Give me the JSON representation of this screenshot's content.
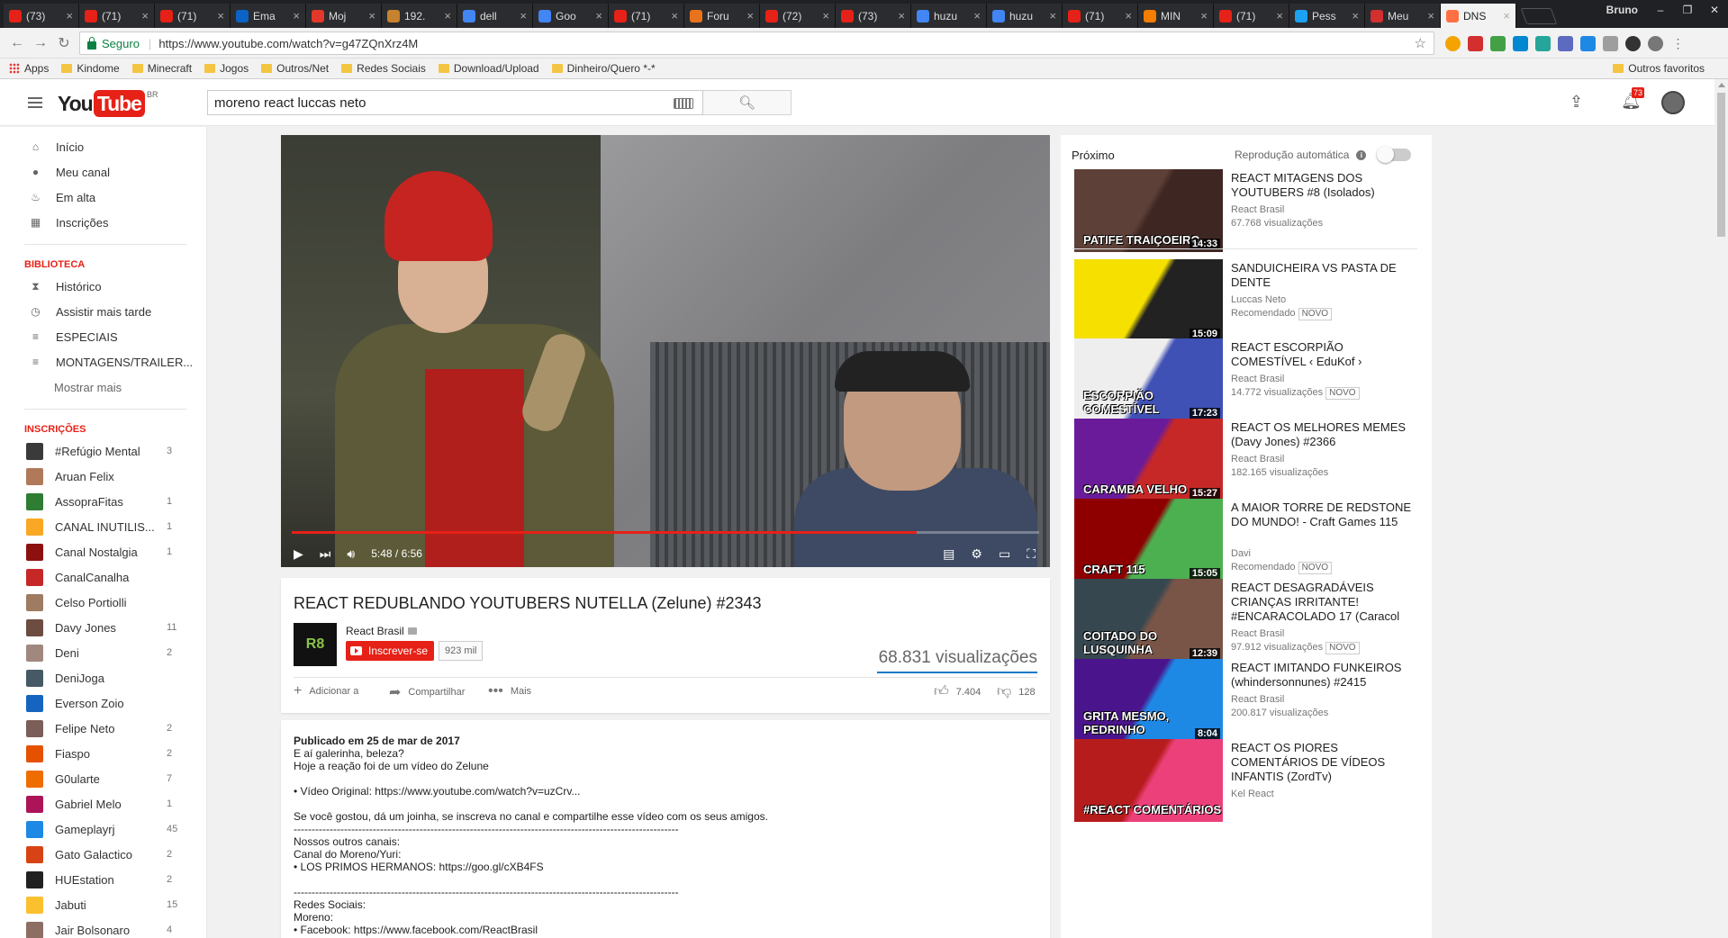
{
  "browser": {
    "tabs": [
      {
        "label": "(73)",
        "color": "#e62117",
        "active": false
      },
      {
        "label": "(71)",
        "color": "#e62117",
        "active": false
      },
      {
        "label": "(71)",
        "color": "#e62117",
        "active": false
      },
      {
        "label": "Ema",
        "color": "#0b63c5",
        "active": false
      },
      {
        "label": "Moj",
        "color": "#e2372a",
        "active": false
      },
      {
        "label": "192.",
        "color": "#c7822f",
        "active": false
      },
      {
        "label": "dell",
        "color": "#4285f4",
        "active": false
      },
      {
        "label": "Goo",
        "color": "#4285f4",
        "active": false
      },
      {
        "label": "(71)",
        "color": "#e62117",
        "active": false
      },
      {
        "label": "Foru",
        "color": "#e8731c",
        "active": false
      },
      {
        "label": "(72)",
        "color": "#e62117",
        "active": false
      },
      {
        "label": "(73)",
        "color": "#e62117",
        "active": false
      },
      {
        "label": "huzu",
        "color": "#4285f4",
        "active": false
      },
      {
        "label": "huzu",
        "color": "#4285f4",
        "active": false
      },
      {
        "label": "(71)",
        "color": "#e62117",
        "active": false
      },
      {
        "label": "MIN",
        "color": "#f57d00",
        "active": false
      },
      {
        "label": "(71)",
        "color": "#e62117",
        "active": false
      },
      {
        "label": "Pess",
        "color": "#1da1f2",
        "active": false
      },
      {
        "label": "Meu",
        "color": "#d32f2f",
        "active": false
      },
      {
        "label": "DNS",
        "color": "#ff7043",
        "active": true
      }
    ],
    "user": "Bruno",
    "secure_label": "Seguro",
    "url": "https://www.youtube.com/watch?v=g47ZQnXrz4M",
    "bookmarks": [
      "Apps",
      "Kindome",
      "Minecraft",
      "Jogos",
      "Outros/Net",
      "Redes Sociais",
      "Download/Upload",
      "Dinheiro/Quero *-*"
    ],
    "other_bookmarks": "Outros favoritos"
  },
  "header": {
    "logo_you": "You",
    "logo_tube": "Tube",
    "logo_region": "BR",
    "search_value": "moreno react luccas neto",
    "notif_count": "73"
  },
  "sidebar": {
    "nav": [
      {
        "label": "Início",
        "icon": "home-icon"
      },
      {
        "label": "Meu canal",
        "icon": "person-icon"
      },
      {
        "label": "Em alta",
        "icon": "flame-icon"
      },
      {
        "label": "Inscrições",
        "icon": "subscriptions-icon"
      }
    ],
    "library_title": "BIBLIOTECA",
    "library": [
      {
        "label": "Histórico",
        "icon": "hourglass-icon"
      },
      {
        "label": "Assistir mais tarde",
        "icon": "clock-icon"
      },
      {
        "label": "ESPECIAIS",
        "icon": "playlist-icon"
      },
      {
        "label": "MONTAGENS/TRAILER...",
        "icon": "playlist-icon"
      }
    ],
    "show_more": "Mostrar mais",
    "subs_title": "INSCRIÇÕES",
    "subs": [
      {
        "name": "#Refúgio Mental",
        "count": "3",
        "color": "#3a3a3a"
      },
      {
        "name": "Aruan Felix",
        "count": "",
        "color": "#b07a5a"
      },
      {
        "name": "AssopraFitas",
        "count": "1",
        "color": "#2e7d32"
      },
      {
        "name": "CANAL INUTILIS...",
        "count": "1",
        "color": "#f9a825"
      },
      {
        "name": "Canal Nostalgia",
        "count": "1",
        "color": "#8d1010"
      },
      {
        "name": "CanalCanalha",
        "count": "",
        "color": "#c62828"
      },
      {
        "name": "Celso Portiolli",
        "count": "",
        "color": "#9e7b61"
      },
      {
        "name": "Davy Jones",
        "count": "11",
        "color": "#6d4c41"
      },
      {
        "name": "Deni",
        "count": "2",
        "color": "#a1887f"
      },
      {
        "name": "DeniJoga",
        "count": "",
        "color": "#455a64"
      },
      {
        "name": "Everson Zoio",
        "count": "",
        "color": "#1565c0"
      },
      {
        "name": "Felipe Neto",
        "count": "2",
        "color": "#7b5e57"
      },
      {
        "name": "Fiaspo",
        "count": "2",
        "color": "#e65100"
      },
      {
        "name": "G0ularte",
        "count": "7",
        "color": "#ef6c00"
      },
      {
        "name": "Gabriel Melo",
        "count": "1",
        "color": "#ad1457"
      },
      {
        "name": "Gameplayrj",
        "count": "45",
        "color": "#1e88e5"
      },
      {
        "name": "Gato Galactico",
        "count": "2",
        "color": "#d84315"
      },
      {
        "name": "HUEstation",
        "count": "2",
        "color": "#212121"
      },
      {
        "name": "Jabuti",
        "count": "15",
        "color": "#fbc02d"
      },
      {
        "name": "Jair Bolsonaro",
        "count": "4",
        "color": "#8d6e63"
      }
    ]
  },
  "player": {
    "time": "5:48 / 6:56",
    "progress": 0.8357
  },
  "video": {
    "title": "REACT REDUBLANDO YOUTUBERS NUTELLA (Zelune) #2343",
    "channel": "React Brasil",
    "subscribe": "Inscrever-se",
    "sub_count": "923 mil",
    "views": "68.831 visualizações",
    "add": "Adicionar a",
    "share": "Compartilhar",
    "more": "Mais",
    "likes": "7.404",
    "dislikes": "128"
  },
  "description": {
    "published": "Publicado em 25 de mar de 2017",
    "lines": [
      "E aí galerinha, beleza?",
      "Hoje a reação foi de um vídeo do Zelune",
      "",
      "• Vídeo Original: https://www.youtube.com/watch?v=uzCrv...",
      "",
      "Se você gostou, dá um joinha, se inscreva no canal e compartilhe esse vídeo com os seus amigos.",
      "-----------------------------------------------------------------------------------------------------------",
      "Nossos outros canais:",
      "Canal do Moreno/Yuri:",
      "• LOS PRIMOS HERMANOS: https://goo.gl/cXB4FS",
      "",
      "-----------------------------------------------------------------------------------------------------------",
      "Redes Sociais:",
      "Moreno:",
      "• Facebook: https://www.facebook.com/ReactBrasil"
    ]
  },
  "sidebar_right": {
    "next_label": "Próximo",
    "autoplay_label": "Reprodução automática",
    "videos": [
      {
        "title": "REACT MITAGENS DOS YOUTUBERS #8 (Isolados)",
        "channel": "React Brasil",
        "meta": "67.768 visualizações",
        "new": "",
        "duration": "14:33",
        "caption": "PATIFE TRAIÇOEIRO",
        "c1": "#5d4037",
        "c2": "#3e2723"
      },
      {
        "title": "SANDUICHEIRA VS PASTA DE DENTE",
        "channel": "Luccas Neto",
        "meta": "Recomendado",
        "new": "NOVO",
        "duration": "15:09",
        "caption": "",
        "c1": "#f5e000",
        "c2": "#222222"
      },
      {
        "title": "REACT ESCORPIÃO COMESTÍVEL ‹ EduKof ›",
        "channel": "React Brasil",
        "meta": "14.772 visualizações",
        "new": "NOVO",
        "duration": "17:23",
        "caption": "ESCORPIÃO COMESTÍVEL",
        "c1": "#eeeeee",
        "c2": "#3f51b5"
      },
      {
        "title": "REACT OS MELHORES MEMES (Davy Jones) #2366",
        "channel": "React Brasil",
        "meta": "182.165 visualizações",
        "new": "",
        "duration": "15:27",
        "caption": "CARAMBA VELHO",
        "c1": "#6a1b9a",
        "c2": "#c62828"
      },
      {
        "title": "A MAIOR TORRE DE REDSTONE DO MUNDO! - Craft Games 115",
        "channel": "Davi",
        "meta": "Recomendado",
        "new": "NOVO",
        "duration": "15:05",
        "caption": "CRAFT 115",
        "c1": "#8e0000",
        "c2": "#4caf50"
      },
      {
        "title": "REACT DESAGRADÁVEIS CRIANÇAS IRRITANTE! #ENCARACOLADO 17 (Caracol",
        "channel": "React Brasil",
        "meta": "97.912 visualizações",
        "new": "NOVO",
        "duration": "12:39",
        "caption": "COITADO DO LUSQUINHA",
        "c1": "#37474f",
        "c2": "#795548"
      },
      {
        "title": "REACT IMITANDO FUNKEIROS (whindersonnunes) #2415",
        "channel": "React Brasil",
        "meta": "200.817 visualizações",
        "new": "",
        "duration": "8:04",
        "caption": "GRITA MESMO, PEDRINHO",
        "c1": "#4a148c",
        "c2": "#1e88e5"
      },
      {
        "title": "REACT OS PIORES COMENTÁRIOS DE VÍDEOS INFANTIS (ZordTv)",
        "channel": "Kel React",
        "meta": "",
        "new": "",
        "duration": "",
        "caption": "#REACT COMENTÁRIOS",
        "c1": "#b71c1c",
        "c2": "#ec407a"
      }
    ]
  }
}
